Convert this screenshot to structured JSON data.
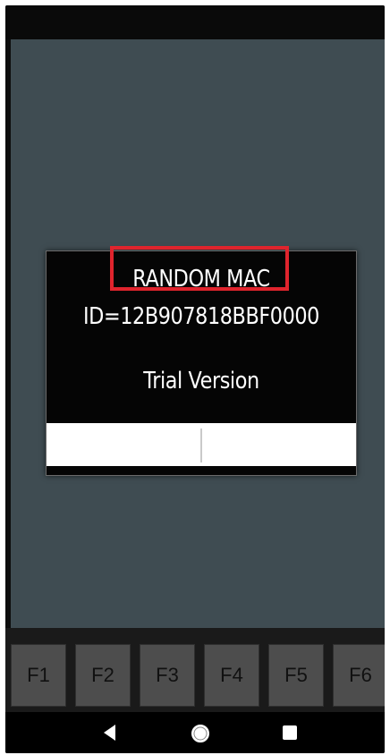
{
  "dialog": {
    "title": "RANDOM MAC",
    "id_text": "ID=12B907818BBF0000",
    "trial_text": "Trial Version"
  },
  "function_keys": [
    "F1",
    "F2",
    "F3",
    "F4",
    "F5",
    "F6"
  ],
  "nav": {
    "back": "back-icon",
    "home": "home-icon",
    "recents": "recents-icon"
  },
  "colors": {
    "app_background": "#3f4c52",
    "highlight": "#e0242d",
    "dialog_background": "#050505",
    "fkey_background": "#4d4d4d"
  }
}
